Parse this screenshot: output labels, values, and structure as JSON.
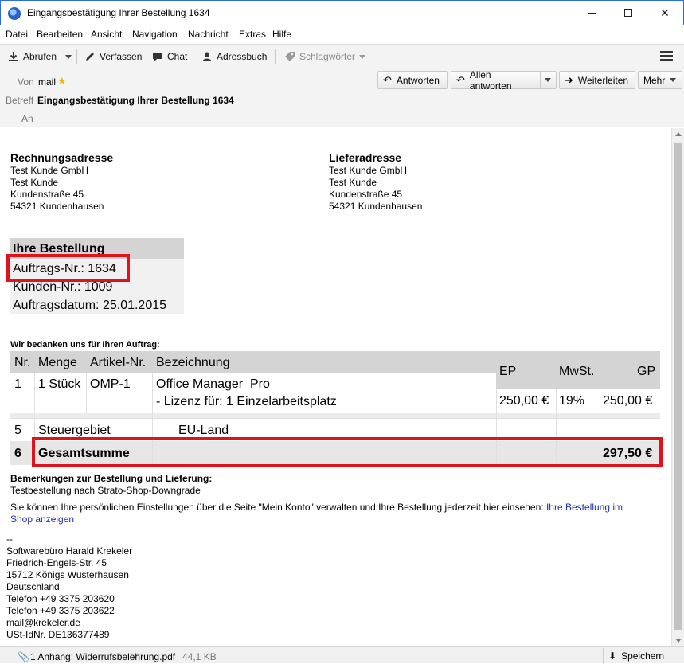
{
  "window": {
    "title": "Eingangsbestätigung Ihrer Bestellung 1634"
  },
  "menu": [
    "Datei",
    "Bearbeiten",
    "Ansicht",
    "Navigation",
    "Nachricht",
    "Extras",
    "Hilfe"
  ],
  "toolbar": {
    "abrufen": "Abrufen",
    "verfassen": "Verfassen",
    "chat": "Chat",
    "adressbuch": "Adressbuch",
    "schlagwoerter": "Schlagwörter"
  },
  "header": {
    "von_label": "Von",
    "von_value": "mail",
    "betreff_label": "Betreff",
    "betreff_value": "Eingangsbestätigung Ihrer Bestellung 1634",
    "an_label": "An",
    "buttons": {
      "antworten": "Antworten",
      "allen": "Allen antworten",
      "weiterleiten": "Weiterleiten",
      "mehr": "Mehr"
    }
  },
  "body": {
    "rechnung": {
      "heading": "Rechnungsadresse",
      "lines": [
        "Test Kunde GmbH",
        "Test Kunde",
        "Kundenstraße 45",
        "54321 Kundenhausen"
      ]
    },
    "liefer": {
      "heading": "Lieferadresse",
      "lines": [
        "Test Kunde GmbH",
        "Test Kunde",
        "Kundenstraße 45",
        "54321 Kundenhausen"
      ]
    },
    "bestellung": {
      "heading": "Ihre Bestellung",
      "auftrag": "Auftrags-Nr.: 1634",
      "kunde": "Kunden-Nr.: 1009",
      "datum": "Auftragsdatum: 25.01.2015"
    },
    "thanks": "Wir bedanken uns für Ihren Auftrag:",
    "table": {
      "headers": {
        "nr": "Nr.",
        "menge": "Menge",
        "artikel": "Artikel-Nr.",
        "bez": "Bezeichnung",
        "ep": "EP",
        "mwst": "MwSt.",
        "gp": "GP"
      },
      "row1": {
        "nr": "1",
        "menge": "1 Stück",
        "artikel": "OMP-1",
        "bez1": "Office Manager  Pro",
        "bez2": "- Lizenz für: 1 Einzelarbeitsplatz",
        "ep": "250,00 €",
        "mwst": "19%",
        "gp": "250,00 €"
      },
      "row5": {
        "nr": "5",
        "menge": "Steuergebiet",
        "bez": "EU-Land"
      },
      "row6": {
        "nr": "6",
        "label": "Gesamtsumme",
        "gp": "297,50 €"
      }
    },
    "bemerkungen_heading": "Bemerkungen zur Bestellung und Lieferung:",
    "bemerkungen_text": "Testbestellung nach Strato-Shop-Downgrade",
    "info_text": "Sie können Ihre persönlichen Einstellungen über die Seite \"Mein Konto\" verwalten und Ihre Bestellung jederzeit hier einsehen:",
    "info_link_1": "Ihre Bestellung im",
    "info_link_2": "Shop anzeigen",
    "signature": [
      "--",
      "Softwarebüro Harald Krekeler",
      "Friedrich-Engels-Str. 45",
      "15712 Königs Wusterhausen",
      "Deutschland",
      "Telefon +49 3375 203620",
      "Telefon +49 3375 203622",
      "mail@krekeler.de",
      "USt-IdNr. DE136377489"
    ]
  },
  "attachment": {
    "label": "1 Anhang: Widerrufsbelehrung.pdf",
    "size": "44,1 KB",
    "save": "Speichern"
  },
  "colors": {
    "highlight": "#e0131d",
    "link": "#1f2fa3"
  }
}
